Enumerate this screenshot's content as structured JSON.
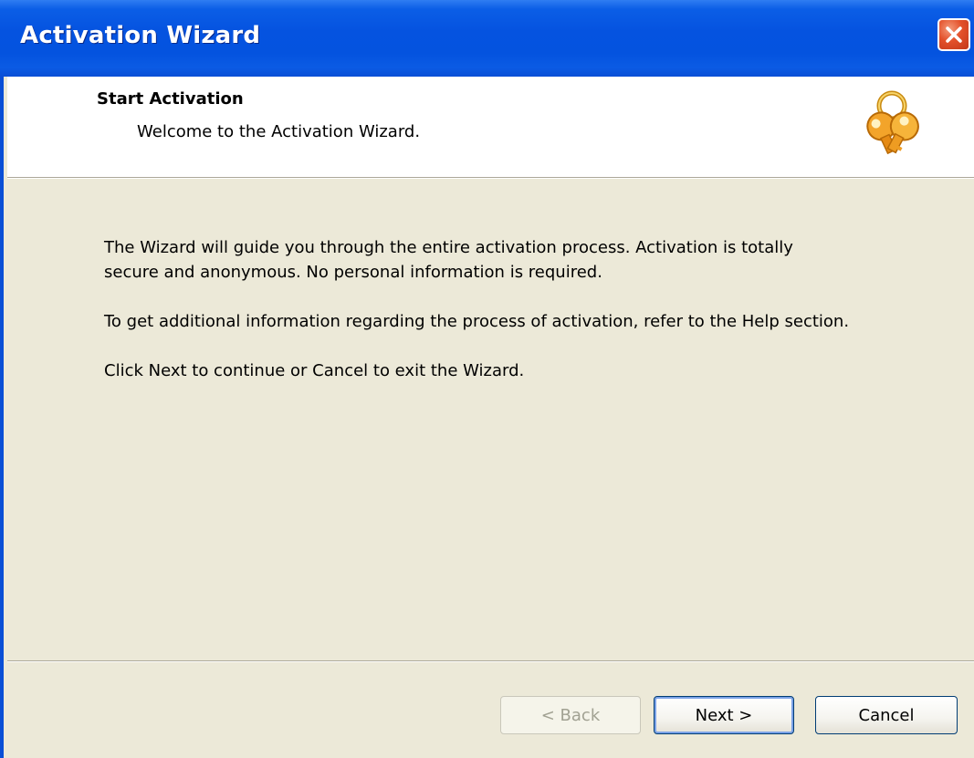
{
  "window": {
    "title": "Activation Wizard"
  },
  "header": {
    "title": "Start Activation",
    "subtitle": "Welcome to the Activation Wizard.",
    "icon": "keys-icon"
  },
  "content": {
    "paragraphs": [
      "The Wizard will guide you through the entire activation process. Activation is totally secure and anonymous. No personal information is required.",
      "To get additional information regarding the process of activation, refer to the Help section.",
      "Click Next to continue or Cancel to exit the Wizard."
    ]
  },
  "buttons": {
    "back_label": "< Back",
    "back_enabled": false,
    "next_label": "Next >",
    "cancel_label": "Cancel"
  },
  "colors": {
    "titlebar": "#0553e0",
    "close_button": "#e3502a",
    "dialog_background": "#ece9d8",
    "header_background": "#ffffff"
  }
}
